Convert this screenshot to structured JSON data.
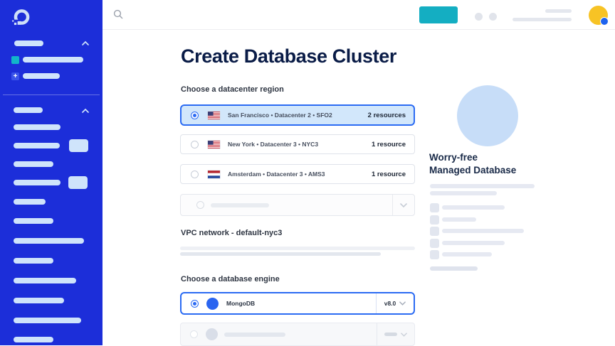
{
  "colors": {
    "sidebar_blue": "#1c2ed9",
    "accent_teal": "#14aec2",
    "selection_blue": "#2b6bf3",
    "selection_bg": "#d2e7fb",
    "avatar_yellow": "#f7c325",
    "heading_navy": "#0a1c47",
    "illustration_blue": "#c7ddf8"
  },
  "icons": {
    "logo": "digitalocean-logo",
    "search": "magnifier",
    "collapse": "chevron-up",
    "expand": "chevron-down"
  },
  "main": {
    "title": "Create Database Cluster",
    "datacenter": {
      "label": "Choose a datacenter region",
      "options": [
        {
          "label": "San Francisco • Datacenter 2 • SFO2",
          "resources": "2 resources",
          "flag": "us",
          "selected": true
        },
        {
          "label": "New York • Datacenter 3 • NYC3",
          "resources": "1 resource",
          "flag": "us",
          "selected": false
        },
        {
          "label": "Amsterdam • Datacenter 3 • AMS3",
          "resources": "1 resource",
          "flag": "nl",
          "selected": false
        }
      ]
    },
    "vpc": {
      "label": "VPC network - default-nyc3"
    },
    "engine": {
      "label": "Choose a database engine",
      "options": [
        {
          "name": "MongoDB",
          "version": "v8.0",
          "selected": true
        }
      ]
    }
  },
  "aside": {
    "title": "Worry-free Managed Database"
  }
}
